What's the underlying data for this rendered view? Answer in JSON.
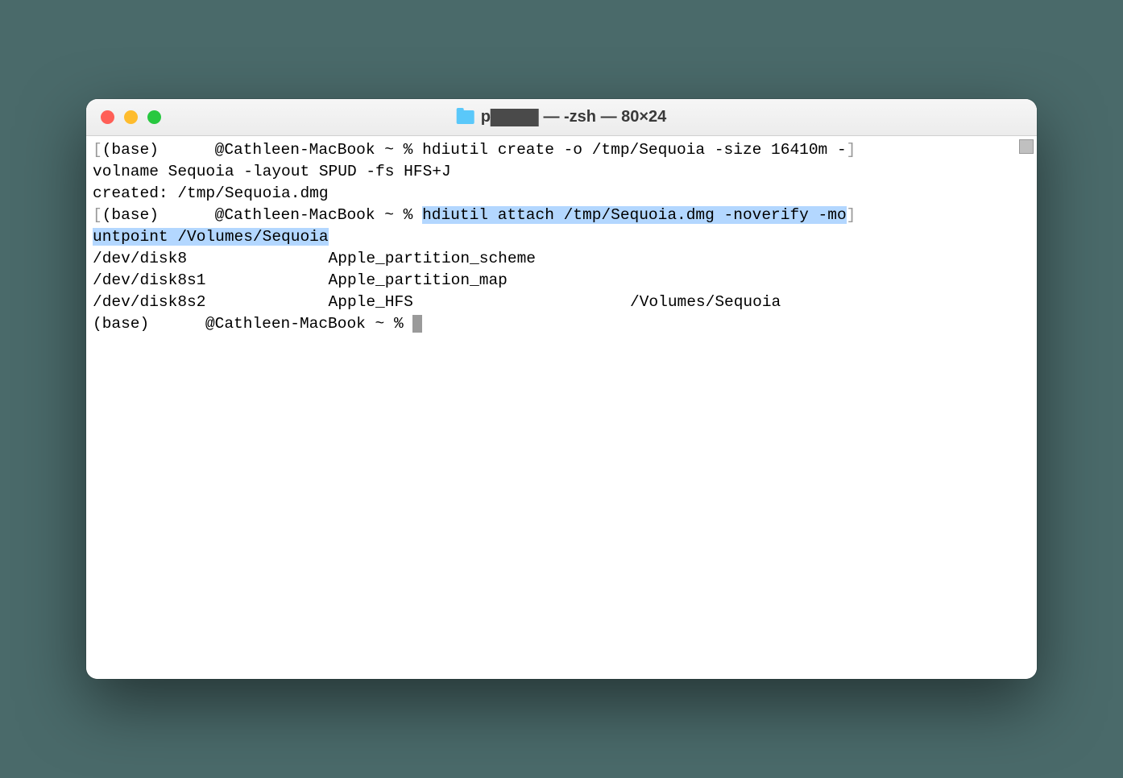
{
  "window": {
    "title_prefix": "p",
    "title_suffix": " — -zsh — 80×24"
  },
  "terminal": {
    "prompt_prefix": "(base) ",
    "prompt_host": "@Cathleen-MacBook ~ % ",
    "line1_cmd": "hdiutil create -o /tmp/Sequoia -size 16410m -",
    "line2": "volname Sequoia -layout SPUD -fs HFS+J",
    "line3": "created: /tmp/Sequoia.dmg",
    "line4_cmd_sel1": "hdiutil attach /tmp/Sequoia.dmg -noverify -mo",
    "line5_sel": "untpoint /Volumes/Sequoia",
    "line6": "/dev/disk8               Apple_partition_scheme          ",
    "line7": "/dev/disk8s1             Apple_partition_map             ",
    "line8": "/dev/disk8s2             Apple_HFS                       /Volumes/Sequoia",
    "line9_end": ""
  },
  "brackets": {
    "open": "[",
    "close": "]"
  }
}
